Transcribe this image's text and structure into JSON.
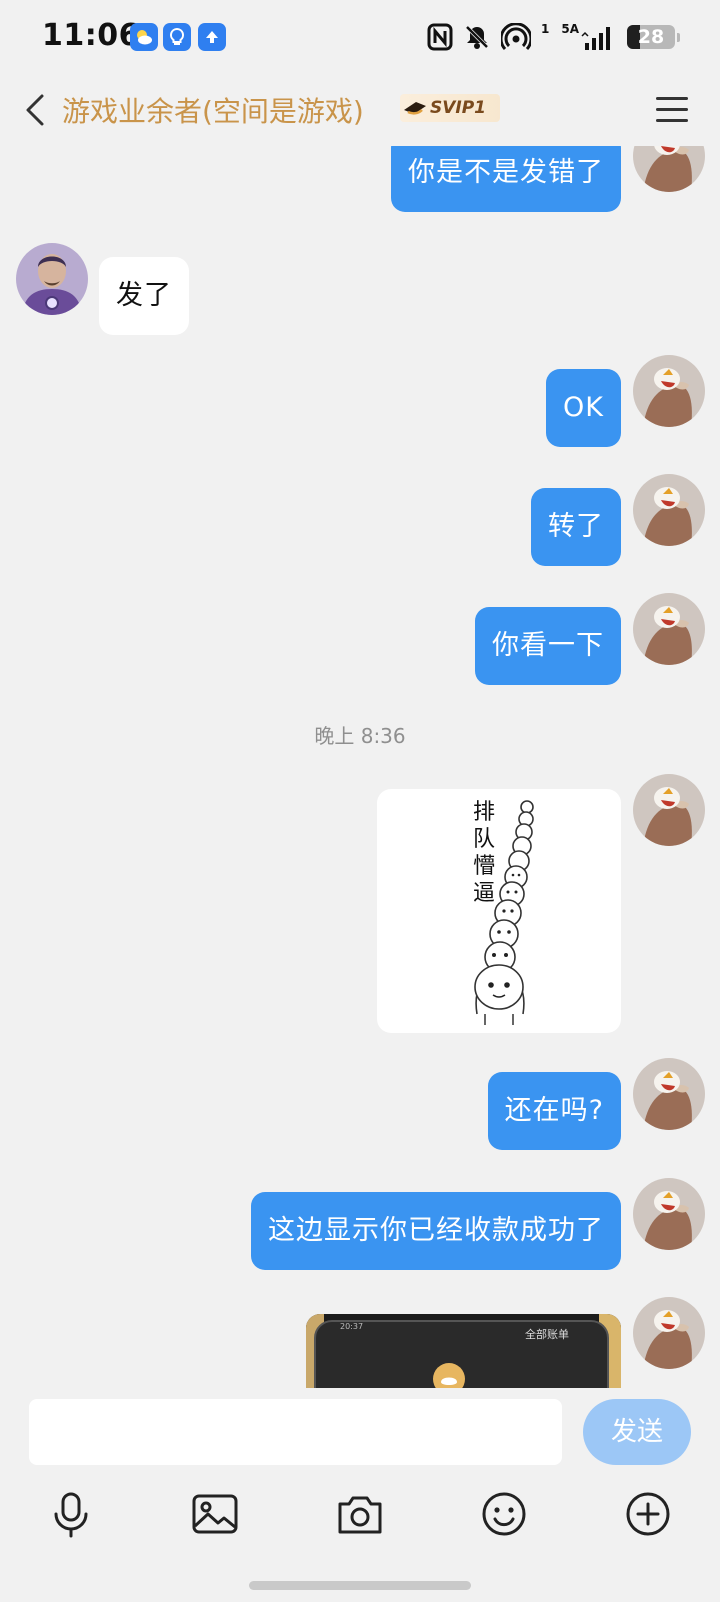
{
  "status_bar": {
    "time": "11:06",
    "network_label": "5A",
    "hotspot_count": "1",
    "battery_percent": "28",
    "battery_level": 0.28,
    "app_icons": [
      "weather-icon",
      "bulb-icon",
      "upload-icon"
    ]
  },
  "header": {
    "title": "游戏业余者(空间是游戏)",
    "vip_badge": "SVIP1"
  },
  "messages": [
    {
      "side": "out",
      "text": "你是不是发错了"
    },
    {
      "side": "in",
      "text": "发了"
    },
    {
      "side": "out",
      "text": "OK"
    },
    {
      "side": "out",
      "text": "转了"
    },
    {
      "side": "out",
      "text": "你看一下"
    },
    {
      "type": "timestamp",
      "text": "晚上 8:36"
    },
    {
      "side": "out",
      "type": "sticker",
      "text": "排队懵逼"
    },
    {
      "side": "out",
      "text": "还在吗?"
    },
    {
      "side": "out",
      "text": "这边显示你已经收款成功了"
    },
    {
      "side": "out",
      "type": "image",
      "text": "全部账单",
      "time_text": "20:37"
    }
  ],
  "input": {
    "value": "",
    "send_label": "发送"
  },
  "colors": {
    "outgoing_bubble": "#3a94f1",
    "incoming_bubble": "#ffffff",
    "send_button": "#9cc7f6",
    "title_gold": "#c9944a",
    "background": "#f1f1f1"
  },
  "toolbar": [
    "microphone-icon",
    "image-icon",
    "camera-icon",
    "emoji-icon",
    "plus-icon"
  ]
}
